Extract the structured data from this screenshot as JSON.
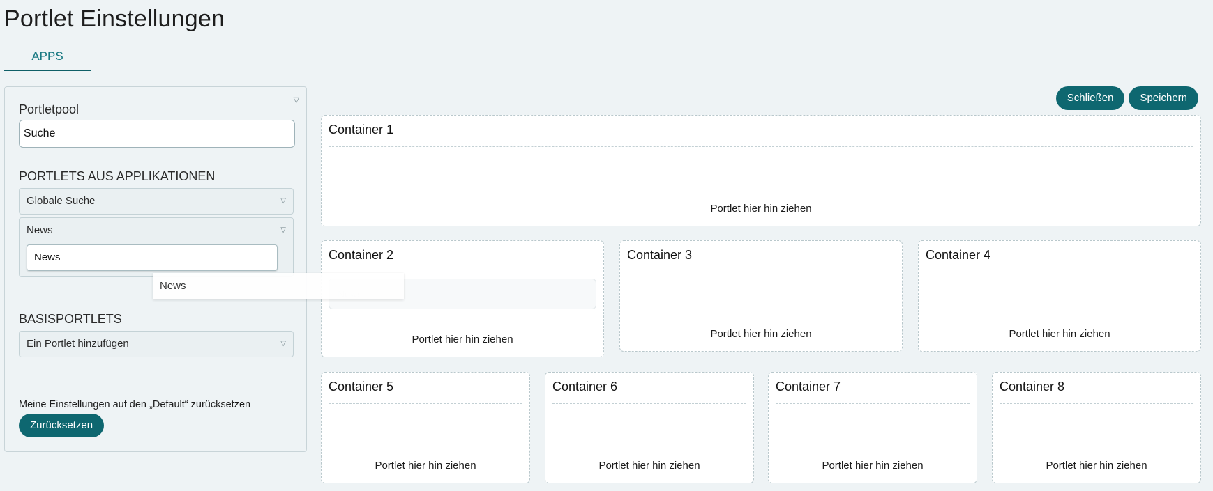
{
  "page": {
    "title": "Portlet Einstellungen"
  },
  "tabs": [
    {
      "label": "APPS",
      "active": true
    }
  ],
  "sidebar": {
    "portletpool_title": "Portletpool",
    "search_value": "Suche",
    "apps_section_title": "PORTLETS AUS APPLIKATIONEN",
    "accordion_globale": "Globale Suche",
    "accordion_news": "News",
    "news_item": "News",
    "base_section_title": "BASISPORTLETS",
    "base_dropdown": "Ein Portlet hinzufügen",
    "reset_text": "Meine Einstellungen auf den „Default“ zurücksetzen",
    "reset_button": "Zurücksetzen"
  },
  "actions": {
    "close": "Schließen",
    "save": "Speichern"
  },
  "containers": [
    {
      "title": "Container 1",
      "hint": "Portlet hier hin ziehen"
    },
    {
      "title": "Container 2",
      "hint": "Portlet hier hin ziehen"
    },
    {
      "title": "Container 3",
      "hint": "Portlet hier hin ziehen"
    },
    {
      "title": "Container 4",
      "hint": "Portlet hier hin ziehen"
    },
    {
      "title": "Container 5",
      "hint": "Portlet hier hin ziehen"
    },
    {
      "title": "Container 6",
      "hint": "Portlet hier hin ziehen"
    },
    {
      "title": "Container 7",
      "hint": "Portlet hier hin ziehen"
    },
    {
      "title": "Container 8",
      "hint": "Portlet hier hin ziehen"
    }
  ],
  "drag": {
    "preview_label": "News",
    "ghost_label": "News"
  },
  "icons": {
    "caret": "triangle-down-icon"
  },
  "colors": {
    "accent": "#0e6770",
    "background": "#eef3f5"
  }
}
